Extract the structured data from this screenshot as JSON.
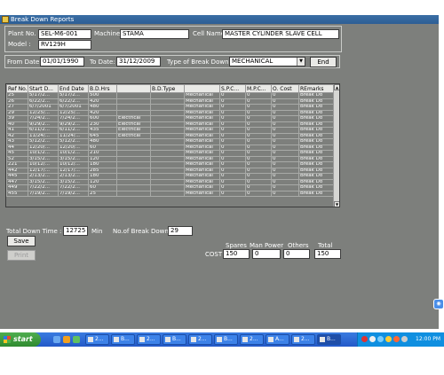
{
  "window": {
    "title": "Break Down Reports"
  },
  "header": {
    "plant_no_label": "Plant No.",
    "plant_no_value": "SEL-M6-001",
    "machine_label": "Machine",
    "machine_value": "STAMA",
    "cell_name_label": "Cell Name",
    "cell_name_value": "MASTER CYLINDER SLAVE CELL",
    "model_label": "Model :",
    "model_value": "RV129H"
  },
  "filter": {
    "from_date_label": "From Date",
    "from_date_value": "01/01/1990",
    "to_date_label": "To Date:",
    "to_date_value": "31/12/2009",
    "type_label": "Type of Break Down",
    "type_value": "MECHANICAL",
    "end_button": "End"
  },
  "table": {
    "columns": [
      "Ref No.",
      "Start D...",
      "End Date",
      "B.D.Hrs",
      "",
      "B.D.Type",
      "",
      "S.P.C...",
      "M.P.C...",
      "O. Cost",
      "REmarks"
    ],
    "rows": [
      [
        "25",
        "5/17/2...",
        "5/17/2...",
        "500",
        "",
        "",
        "Mechanical",
        "0",
        "0",
        "0",
        "Break Do"
      ],
      [
        "26",
        "6/22/2...",
        "6/22/2...",
        "420",
        "",
        "",
        "Mechanical",
        "0",
        "0",
        "0",
        "Break Do"
      ],
      [
        "27",
        "6/7/2001",
        "6/7/2001",
        "480",
        "",
        "",
        "Mechanical",
        "0",
        "0",
        "0",
        "Break Do"
      ],
      [
        "29",
        "12/25/...",
        "12/25/...",
        "420",
        "",
        "",
        "Mechanical",
        "0",
        "0",
        "0",
        "Break Do"
      ],
      [
        "39",
        "7/24/2...",
        "7/24/2...",
        "600",
        "Electrical",
        "",
        "Mechanical",
        "0",
        "0",
        "0",
        "Break Do"
      ],
      [
        "40",
        "9/29/2...",
        "9/29/2...",
        "230",
        "Electrical",
        "",
        "Mechanical",
        "0",
        "0",
        "0",
        "Break Do"
      ],
      [
        "41",
        "6/11/2...",
        "6/11/2...",
        "435",
        "Electrical",
        "",
        "Mechanical",
        "0",
        "0",
        "0",
        "Break Do"
      ],
      [
        "42",
        "11/24/...",
        "11/24/...",
        "645",
        "Electrical",
        "",
        "Mechanical",
        "0",
        "0",
        "0",
        "Break Do"
      ],
      [
        "43",
        "5/12/2...",
        "5/12/2...",
        "480",
        "",
        "",
        "Mechanical",
        "0",
        "0",
        "0",
        "Break Do"
      ],
      [
        "44",
        "12/20/...",
        "12/20/...",
        "60",
        "",
        "",
        "Mechanical",
        "0",
        "0",
        "0",
        "Break Do"
      ],
      [
        "45",
        "10/1/2...",
        "10/1/2...",
        "210",
        "",
        "",
        "Mechanical",
        "0",
        "0",
        "0",
        "Break Do"
      ],
      [
        "52",
        "3/15/2...",
        "3/15/2...",
        "120",
        "",
        "",
        "Mechanical",
        "0",
        "0",
        "0",
        "Break Do"
      ],
      [
        "221",
        "10/12/...",
        "10/12/...",
        "180",
        "",
        "",
        "Mechanical",
        "0",
        "0",
        "0",
        "Break Do"
      ],
      [
        "442",
        "12/17/...",
        "12/17/...",
        "285",
        "",
        "",
        "Mechanical",
        "0",
        "0",
        "0",
        "Break Do"
      ],
      [
        "445",
        "2/13/2...",
        "2/13/2...",
        "180",
        "",
        "",
        "Mechanical",
        "0",
        "0",
        "0",
        "Break Do"
      ],
      [
        "447",
        "3/15/2...",
        "3/15/2...",
        "120",
        "",
        "",
        "Mechanical",
        "0",
        "0",
        "0",
        "Break Do"
      ],
      [
        "449",
        "7/22/2...",
        "7/22/2...",
        "60",
        "",
        "",
        "Mechanical",
        "0",
        "0",
        "0",
        "Break Do"
      ],
      [
        "455",
        "7/19/2...",
        "7/19/2...",
        "25",
        "",
        "",
        "Mechanical",
        "0",
        "0",
        "0",
        "Break Do"
      ]
    ]
  },
  "summary": {
    "total_down_time_label": "Total Down Time :",
    "total_down_time_value": "12725",
    "min_label": "Min",
    "no_of_breakdown_label": "No.of Break Down",
    "no_of_breakdown_value": "29",
    "save_button": "Save",
    "print_button": "Print",
    "cost_label": "COST",
    "spares_label": "Spares",
    "spares_value": "150",
    "man_power_label": "Man Power",
    "man_power_value": "0",
    "others_label": "Others",
    "others_value": "0",
    "total_label": "Total",
    "total_value": "150"
  },
  "taskbar": {
    "start_label": "start",
    "buttons": [
      "2...",
      "B...",
      "2...",
      "B...",
      "2...",
      "B...",
      "2...",
      "A...",
      "2...",
      "B..."
    ],
    "clock": "12:00 PM"
  },
  "colors": {
    "window_bg": "#7d7f7c",
    "titlebar": "#3a6ea5",
    "taskbar": "#2359c8",
    "start": "#2f8a2f"
  }
}
